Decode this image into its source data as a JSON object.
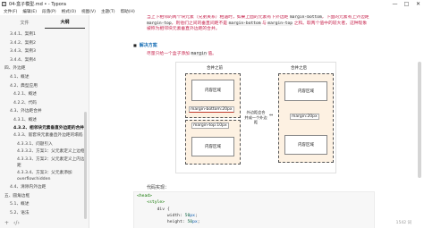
{
  "window": {
    "icon": "T",
    "title": "04-盒子模型.md • - Typora",
    "controls": [
      "—",
      "□",
      "✕"
    ]
  },
  "menu": [
    "文件(F)",
    "编辑(E)",
    "段落(P)",
    "格式(O)",
    "视图(V)",
    "主题(T)",
    "帮助(H)"
  ],
  "sidebar": {
    "tabs": [
      "文件",
      "大纲"
    ],
    "items": [
      {
        "text": "3.4.1、案例1",
        "level": 2
      },
      {
        "text": "3.4.2、案例2",
        "level": 2
      },
      {
        "text": "3.4.3、案例3",
        "level": 2
      },
      {
        "text": "3.4.4、案例4",
        "level": 2
      },
      {
        "text": "四、外边距",
        "level": 1
      },
      {
        "text": "4.1、概述",
        "level": 2
      },
      {
        "text": "4.2、典型应用",
        "level": 2
      },
      {
        "text": "4.2.1、概述",
        "level": 3
      },
      {
        "text": "4.2.2、代码",
        "level": 3
      },
      {
        "text": "4.3、外边距合并",
        "level": 2
      },
      {
        "text": "4.3.1、概述",
        "level": 3
      },
      {
        "text": "4.3.2、相邻块元素垂直外边距的合并",
        "level": 3,
        "active": true
      },
      {
        "text": "4.3.3、嵌套块元素垂直外边距的塌陷",
        "level": 3
      },
      {
        "text": "4.3.3.1、问题引入",
        "level": 4
      },
      {
        "text": "4.3.3.2、方案1：父元素定义上边框",
        "level": 4
      },
      {
        "text": "4.3.3.3、方案2：父元素定义上内边距",
        "level": 4
      },
      {
        "text": "4.3.3.4、方案3：父元素添加overflow:hidden",
        "level": 4
      },
      {
        "text": "4.4、清除内外边距",
        "level": 2
      },
      {
        "text": "五、圆角边框",
        "level": 1
      },
      {
        "text": "5.1、概述",
        "level": 2
      },
      {
        "text": "5.2、语法",
        "level": 2
      }
    ],
    "bottom": [
      "+",
      "‹/›"
    ]
  },
  "content": {
    "paragraph": [
      {
        "t": "当上下相邻的两个块元素（兄弟关系）相遇时，如果上面的元素有下外边距 ",
        "code": false
      },
      {
        "t": "margin-bottom",
        "code": true
      },
      {
        "t": "，下面的元素有上外边距 ",
        "code": false
      },
      {
        "t": "margin-top",
        "code": true
      },
      {
        "t": "，则他们之间的垂直间距不是 ",
        "code": false
      },
      {
        "t": "margin-bottom",
        "code": true
      },
      {
        "t": " 与 ",
        "code": false
      },
      {
        "t": "margin-top",
        "code": true
      },
      {
        "t": " 之和。取两个值中的较大者，这种现象被称为相邻块元素垂直外边距的合并。",
        "code": false
      }
    ],
    "heading": "解决方案",
    "heading_bullet": "■",
    "solution": [
      {
        "t": "尽量只给一个盒子添加 ",
        "code": false
      },
      {
        "t": "margin",
        "code": true
      },
      {
        "t": " 值。",
        "code": false
      }
    ],
    "diagram": {
      "left_title": "合并之前",
      "right_title": "合并之后",
      "box_label": "内容区域",
      "margin_bottom_label": "margin-bottom:20px",
      "margin_top_label": "margin-top:10px",
      "right_label": "margin:20px",
      "note_line1": "外边距会合",
      "note_line2": "并成一个外边距",
      "equiv": "⇔"
    },
    "code_label": "代码实现：",
    "code_lines": [
      {
        "segs": [
          {
            "t": "<head>",
            "c": "c-tag"
          }
        ]
      },
      {
        "segs": [
          {
            "t": "    <style>",
            "c": "c-tag"
          }
        ]
      },
      {
        "segs": [
          {
            "t": "        div {",
            "c": "c-prop"
          }
        ]
      },
      {
        "segs": [
          {
            "t": "            width: ",
            "c": "c-prop"
          },
          {
            "t": "50",
            "c": "c-num"
          },
          {
            "t": "px",
            "c": "c-unit"
          },
          {
            "t": ";",
            "c": "c-prop"
          }
        ]
      },
      {
        "segs": [
          {
            "t": "            height: ",
            "c": "c-prop"
          },
          {
            "t": "50",
            "c": "c-num"
          },
          {
            "t": "px",
            "c": "c-unit"
          },
          {
            "t": ";",
            "c": "c-prop"
          }
        ]
      },
      {
        "segs": [
          {
            "t": "            ...",
            "c": "c-prop"
          }
        ]
      }
    ],
    "word_count": "1542 词"
  }
}
